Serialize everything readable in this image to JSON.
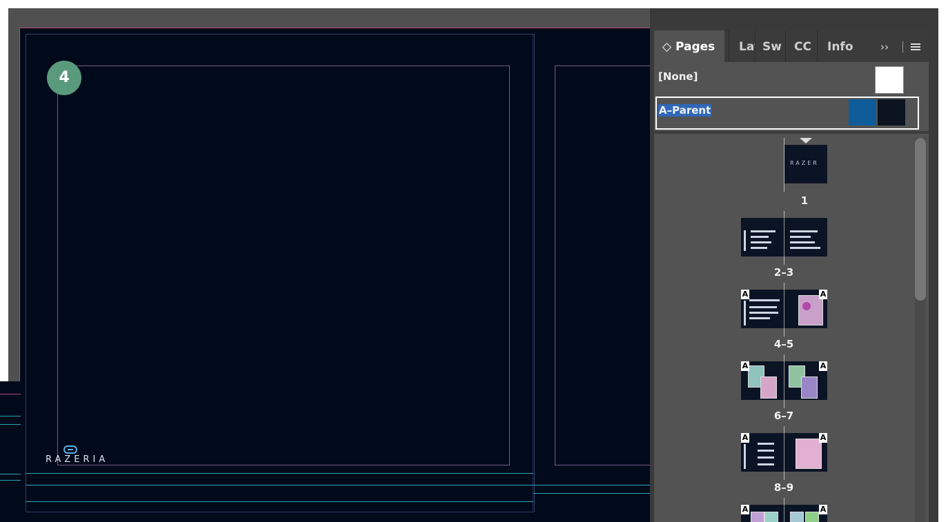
{
  "document": {
    "page_badge": "4",
    "logo_text": "RAZERIA"
  },
  "panel": {
    "tabs": [
      {
        "label": "◇ Pages",
        "active": true
      },
      {
        "label": "Lay"
      },
      {
        "label": "Sw"
      },
      {
        "label": "CC"
      },
      {
        "label": "Info"
      }
    ],
    "overflow_label": "››",
    "parents": [
      {
        "label": "[None]"
      },
      {
        "label": "A–Parent",
        "selected": true
      }
    ],
    "pages": [
      {
        "number": "1",
        "parent_marks": false
      },
      {
        "number": "2–3",
        "parent_marks": false
      },
      {
        "number": "4–5",
        "parent_marks": true
      },
      {
        "number": "6–7",
        "parent_marks": true
      },
      {
        "number": "8–9",
        "parent_marks": true
      },
      {
        "number": "",
        "parent_marks": true
      }
    ],
    "parent_mark_label": "A",
    "cover_text": "RAZER"
  },
  "colors": {
    "document_bg": "#010a1a",
    "badge": "#5a9a7c",
    "selection": "#2f68b8",
    "panel_bg": "#535353"
  }
}
